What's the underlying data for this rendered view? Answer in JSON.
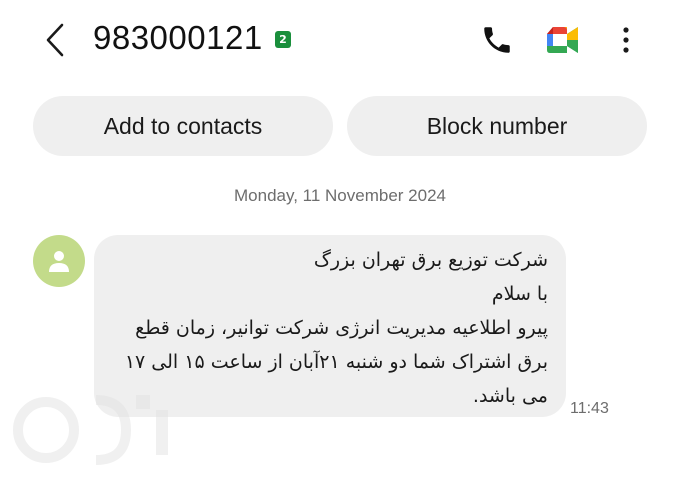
{
  "header": {
    "title": "983000121",
    "sim_badge": "2",
    "back_icon": "chevron-left-icon",
    "call_icon": "phone-icon",
    "video_icon": "google-meet-icon",
    "more_icon": "more-vertical-icon"
  },
  "actions": {
    "add_contact_label": "Add to contacts",
    "block_label": "Block number"
  },
  "conversation": {
    "date_divider": "Monday, 11 November 2024",
    "message": {
      "text": "شرکت توزیع برق تهران بزرگ\nبا سلام\nپیرو اطلاعیه مدیریت انرژی شرکت توانیر، زمان قطع برق اشتراک شما دو شنبه ۲۱آبان از ساعت ۱۵ الی ۱۷ می باشد.",
      "time": "11:43"
    }
  },
  "colors": {
    "avatar_bg": "#c3db8a",
    "bubble_bg": "#efefef",
    "button_bg": "#efefef",
    "sim_badge": "#1a8f3c"
  }
}
